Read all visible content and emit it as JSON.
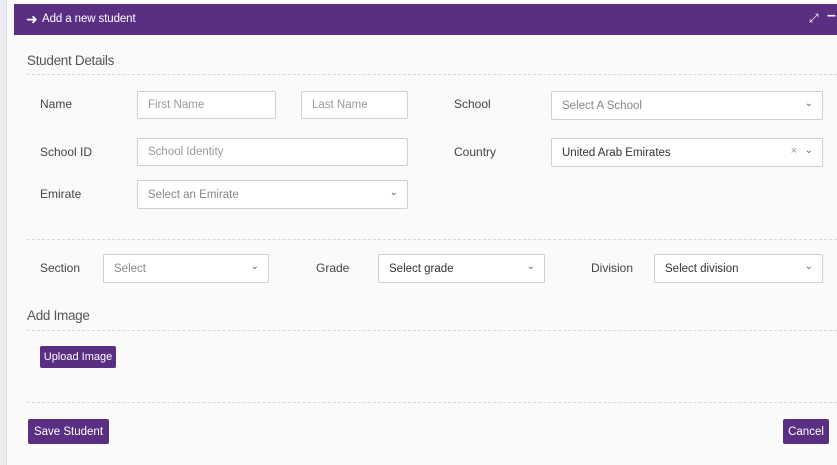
{
  "header": {
    "title": "Add a new student",
    "back_icon": "arrow-right-icon",
    "expand_icon": "expand-icon",
    "minimize_icon": "minimize-icon",
    "background": "#5a2e83"
  },
  "student_details": {
    "heading": "Student Details",
    "name": {
      "label": "Name",
      "first_placeholder": "First Name",
      "last_placeholder": "Last Name"
    },
    "school": {
      "label": "School",
      "placeholder": "Select A School"
    },
    "school_id": {
      "label": "School ID",
      "placeholder": "School Identity"
    },
    "country": {
      "label": "Country",
      "value": "United Arab Emirates",
      "clear_glyph": "×"
    },
    "emirate": {
      "label": "Emirate",
      "placeholder": "Select an Emirate"
    }
  },
  "placement": {
    "section": {
      "label": "Section",
      "placeholder": "Select"
    },
    "grade": {
      "label": "Grade",
      "placeholder": "Select grade"
    },
    "division": {
      "label": "Division",
      "placeholder": "Select division"
    }
  },
  "image": {
    "heading": "Add Image",
    "upload_label": "Upload Image"
  },
  "actions": {
    "save_label": "Save Student",
    "cancel_label": "Cancel"
  }
}
